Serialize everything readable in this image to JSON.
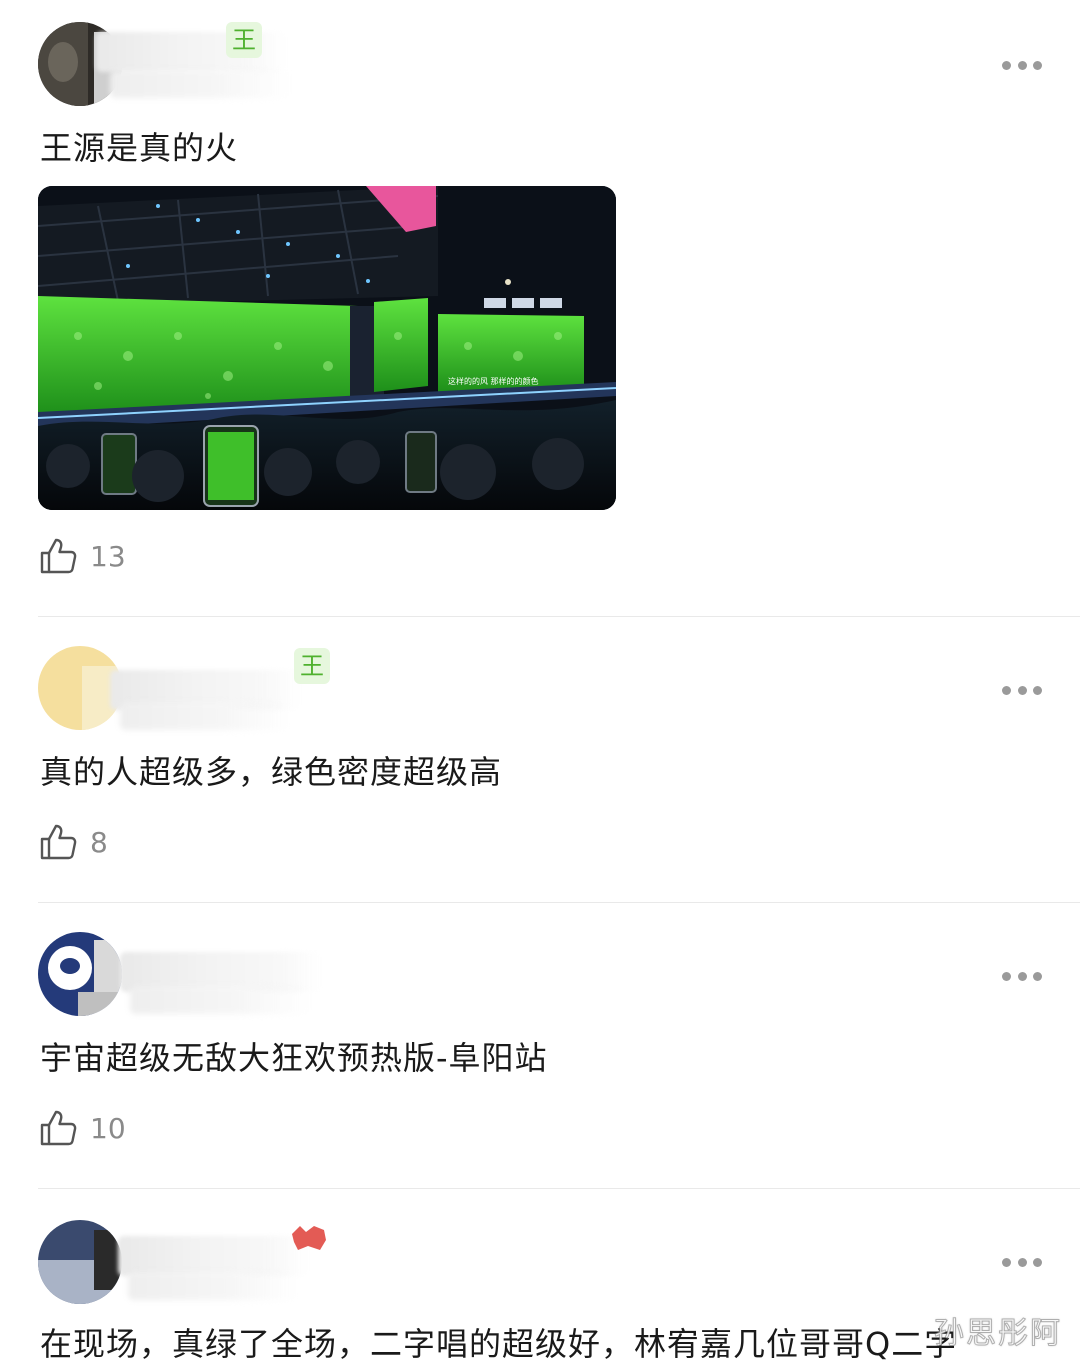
{
  "comments": [
    {
      "badge": "王",
      "text": "王源是真的火",
      "likes": "13",
      "has_photo": true
    },
    {
      "badge": "王",
      "text": "真的人超级多，绿色密度超级高",
      "likes": "8"
    },
    {
      "text": "宇宙超级无敌大狂欢预热版-阜阳站",
      "likes": "10"
    },
    {
      "text": "在现场，真绿了全场，二字唱的超级好，林宥嘉几位哥哥Q二字"
    }
  ],
  "photo": {
    "screen_caption": "这样的的风 那样的的颜色"
  },
  "watermark": "孙思彤阿",
  "colors": {
    "badge_green": "#4fb12e",
    "badge_bg": "#e6f7dd",
    "stage_green": "#3fbf2a"
  },
  "icons": [
    "thumbs-up-icon",
    "more-options-icon"
  ]
}
